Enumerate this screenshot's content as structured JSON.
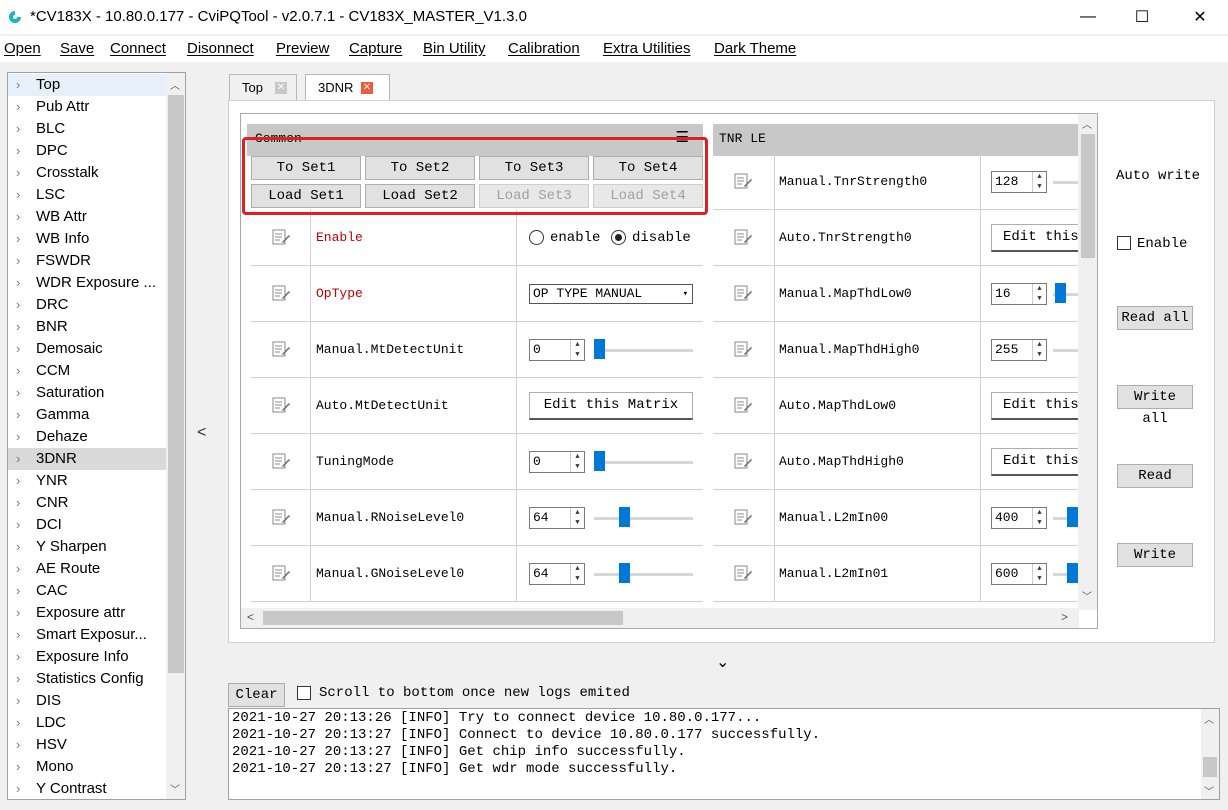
{
  "window": {
    "title": "*CV183X - 10.80.0.177 - CviPQTool - v2.0.7.1 - CV183X_MASTER_V1.3.0",
    "minimize": "—",
    "maximize": "☐",
    "close": "✕"
  },
  "menu": [
    "Open",
    "Save",
    "Connect",
    "Disonnect",
    "Preview",
    "Capture",
    "Bin Utility",
    "Calibration",
    "Extra Utilities",
    "Dark Theme"
  ],
  "tree": {
    "items": [
      "Top",
      "Pub Attr",
      "BLC",
      "DPC",
      "Crosstalk",
      "LSC",
      "WB Attr",
      "WB Info",
      "FSWDR",
      "WDR Exposure ...",
      "DRC",
      "BNR",
      "Demosaic",
      "CCM",
      "Saturation",
      "Gamma",
      "Dehaze",
      "3DNR",
      "YNR",
      "CNR",
      "DCI",
      "Y Sharpen",
      "AE Route",
      "CAC",
      "Exposure attr",
      "Smart Exposur...",
      "Exposure Info",
      "Statistics Config",
      "DIS",
      "LDC",
      "HSV",
      "Mono",
      "Y Contrast"
    ],
    "selected": "3DNR",
    "collapse_arrow": "<"
  },
  "tabs": [
    {
      "label": "Top",
      "close": "✕"
    },
    {
      "label": "3DNR",
      "close": "✕"
    }
  ],
  "common": {
    "title": "Common",
    "menu_icon": "☰",
    "set_buttons": [
      "To Set1",
      "To Set2",
      "To Set3",
      "To Set4"
    ],
    "load_buttons": [
      "Load Set1",
      "Load Set2",
      "Load Set3",
      "Load Set4"
    ],
    "rows": [
      {
        "label": "Enable",
        "radio1": "enable",
        "radio2": "disable"
      },
      {
        "label": "OpType",
        "select": "OP TYPE MANUAL"
      },
      {
        "label": "Manual.MtDetectUnit",
        "value": "0",
        "level": 0.0
      },
      {
        "label": "Auto.MtDetectUnit",
        "button": "Edit this Matrix"
      },
      {
        "label": "TuningMode",
        "value": "0",
        "level": 0.0
      },
      {
        "label": "Manual.RNoiseLevel0",
        "value": "64",
        "level": 0.25
      },
      {
        "label": "Manual.GNoiseLevel0",
        "value": "64",
        "level": 0.25
      }
    ]
  },
  "tnr": {
    "title": "TNR LE",
    "rows": [
      {
        "label": "Manual.TnrStrength0",
        "value": "128"
      },
      {
        "label": "Auto.TnrStrength0",
        "button": "Edit this"
      },
      {
        "label": "Manual.MapThdLow0",
        "value": "16"
      },
      {
        "label": "Manual.MapThdHigh0",
        "value": "255"
      },
      {
        "label": "Auto.MapThdLow0",
        "button": "Edit this"
      },
      {
        "label": "Auto.MapThdHigh0",
        "button": "Edit this"
      },
      {
        "label": "Manual.L2mIn00",
        "value": "400"
      },
      {
        "label": "Manual.L2mIn01",
        "value": "600"
      }
    ]
  },
  "right_panel": {
    "auto_write": "Auto write",
    "enable": "Enable",
    "read_all": "Read all",
    "write_all": "Write all",
    "read": "Read",
    "write": "Write"
  },
  "expand_arrow": "⌄",
  "log": {
    "clear": "Clear",
    "scroll_label": "Scroll to bottom once new logs emited",
    "lines": [
      "2021-10-27 20:13:26 [INFO] Try to connect device 10.80.0.177...",
      "2021-10-27 20:13:27 [INFO] Connect to device 10.80.0.177 successfully.",
      "2021-10-27 20:13:27 [INFO] Get chip info successfully.",
      "2021-10-27 20:13:27 [INFO] Get wdr mode successfully."
    ]
  },
  "colors": {
    "accent": "#0078d7",
    "highlight": "#e02020",
    "required_label": "#c00000"
  }
}
